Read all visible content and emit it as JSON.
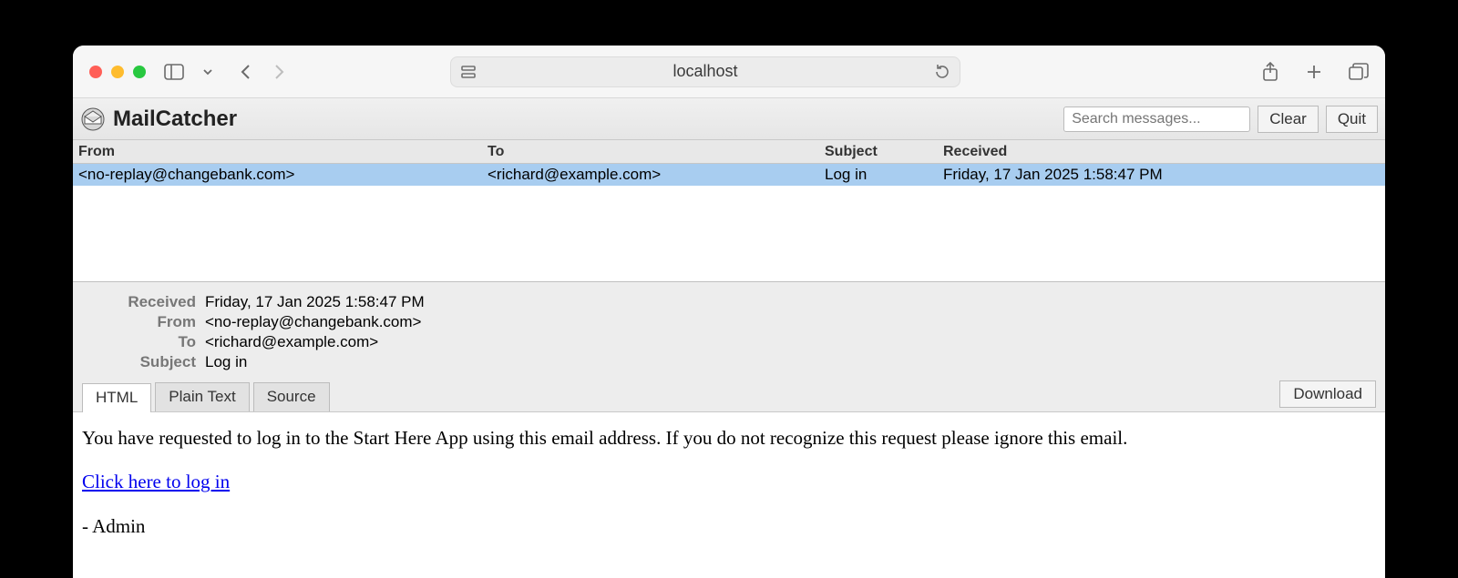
{
  "browser": {
    "address": "localhost"
  },
  "app": {
    "title": "MailCatcher",
    "search_placeholder": "Search messages...",
    "clear_label": "Clear",
    "quit_label": "Quit"
  },
  "columns": {
    "from": "From",
    "to": "To",
    "subject": "Subject",
    "received": "Received"
  },
  "messages": [
    {
      "from": "<no-replay@changebank.com>",
      "to": "<richard@example.com>",
      "subject": "Log in",
      "received": "Friday, 17 Jan 2025 1:58:47 PM",
      "selected": true
    }
  ],
  "detail": {
    "labels": {
      "received": "Received",
      "from": "From",
      "to": "To",
      "subject": "Subject"
    },
    "received": "Friday, 17 Jan 2025 1:58:47 PM",
    "from": "<no-replay@changebank.com>",
    "to": "<richard@example.com>",
    "subject": "Log in"
  },
  "tabs": {
    "html": "HTML",
    "plain": "Plain Text",
    "source": "Source",
    "download": "Download"
  },
  "body": {
    "p1": "You have requested to log in to the Start Here App using this email address. If you do not recognize this request please ignore this email.",
    "link": "Click here to log in",
    "sig": "- Admin"
  }
}
